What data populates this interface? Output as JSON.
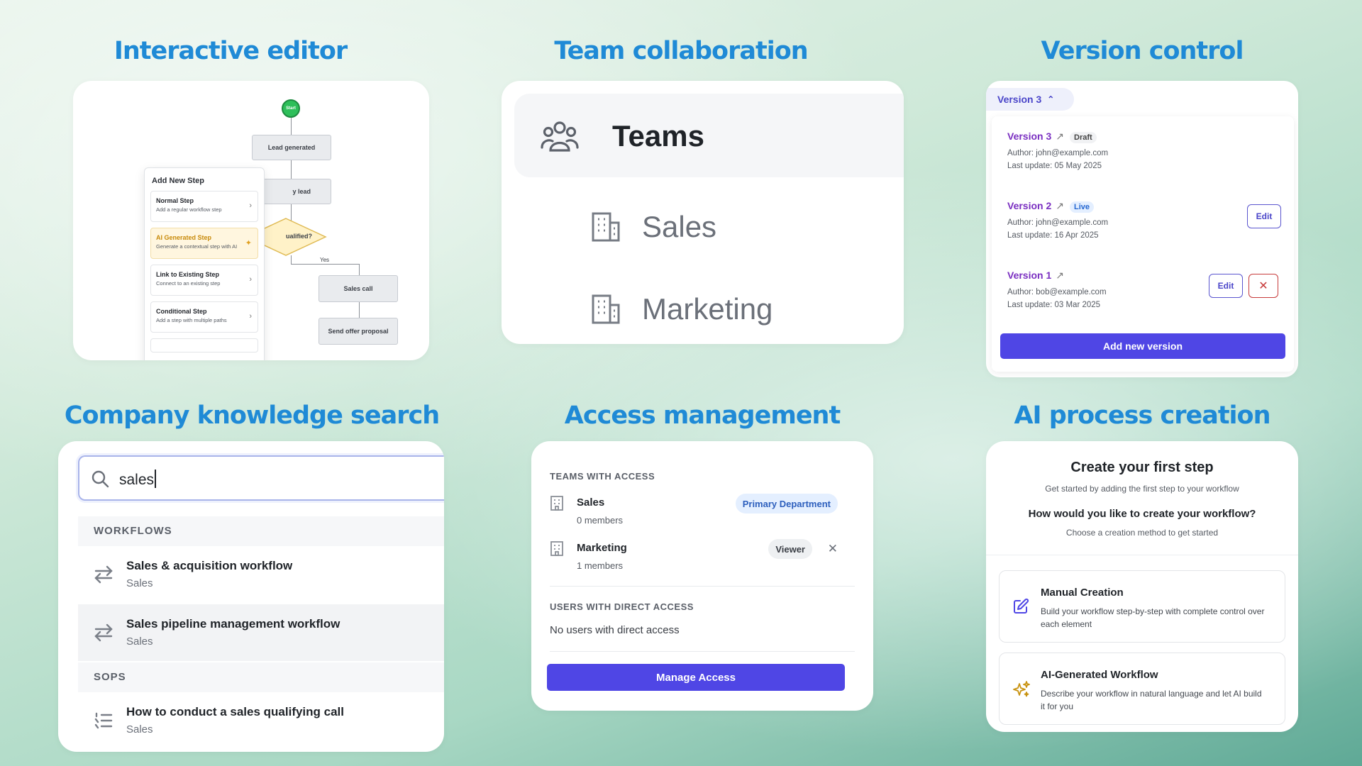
{
  "headings": {
    "editor": "Interactive editor",
    "team": "Team collaboration",
    "version": "Version control",
    "search": "Company knowledge search",
    "access": "Access management",
    "ai": "AI process creation"
  },
  "editor": {
    "start": "Start",
    "nodes": {
      "lead_generated": "Lead generated",
      "qualify_partial": "y lead",
      "decision_partial": "ualified?",
      "yes": "Yes",
      "sales_call": "Sales call",
      "send_offer": "Send offer proposal"
    },
    "panel": {
      "title": "Add New Step",
      "options": [
        {
          "title": "Normal Step",
          "desc": "Add a regular workflow step"
        },
        {
          "title": "AI Generated Step",
          "desc": "Generate a contextual step with AI"
        },
        {
          "title": "Link to Existing Step",
          "desc": "Connect to an existing step"
        },
        {
          "title": "Conditional Step",
          "desc": "Add a step with multiple paths"
        }
      ]
    }
  },
  "team": {
    "teams_label": "Teams",
    "items": [
      "Sales",
      "Marketing"
    ]
  },
  "version": {
    "selector": "Version 3",
    "items": [
      {
        "name": "Version 3",
        "badge": "Draft",
        "author": "Author: john@example.com",
        "updated": "Last update: 05 May 2025"
      },
      {
        "name": "Version 2",
        "badge": "Live",
        "author": "Author: john@example.com",
        "updated": "Last update: 16 Apr 2025",
        "edit": "Edit"
      },
      {
        "name": "Version 1",
        "author": "Author: bob@example.com",
        "updated": "Last update: 03 Mar 2025",
        "edit": "Edit"
      }
    ],
    "add_button": "Add new version"
  },
  "search": {
    "query": "sales",
    "workflows_header": "WORKFLOWS",
    "workflows": [
      {
        "title": "Sales & acquisition workflow",
        "sub": "Sales"
      },
      {
        "title": "Sales pipeline management workflow",
        "sub": "Sales"
      }
    ],
    "sops_header": "SOPS",
    "sops": [
      {
        "title": "How to conduct a sales qualifying call",
        "sub": "Sales"
      }
    ]
  },
  "access": {
    "teams_header": "TEAMS WITH ACCESS",
    "teams": [
      {
        "name": "Sales",
        "members": "0 members",
        "pill": "Primary Department"
      },
      {
        "name": "Marketing",
        "members": "1 members",
        "pill": "Viewer"
      }
    ],
    "users_header": "USERS WITH DIRECT ACCESS",
    "no_users": "No users with direct access",
    "button": "Manage Access"
  },
  "ai": {
    "title": "Create your first step",
    "subtitle": "Get started by adding the first step to your workflow",
    "question": "How would you like to create your workflow?",
    "hint": "Choose a creation method to get started",
    "options": [
      {
        "title": "Manual Creation",
        "desc": "Build your workflow step-by-step with complete control over each element",
        "icon": "edit-icon"
      },
      {
        "title": "AI-Generated Workflow",
        "desc": "Describe your workflow in natural language and let AI build it for you",
        "icon": "sparkle-icon"
      }
    ]
  },
  "colors": {
    "heading": "#1f8ad6",
    "primary_button": "#4f46e5",
    "version_name": "#7a2fc1",
    "delete_red": "#c73b3b"
  }
}
